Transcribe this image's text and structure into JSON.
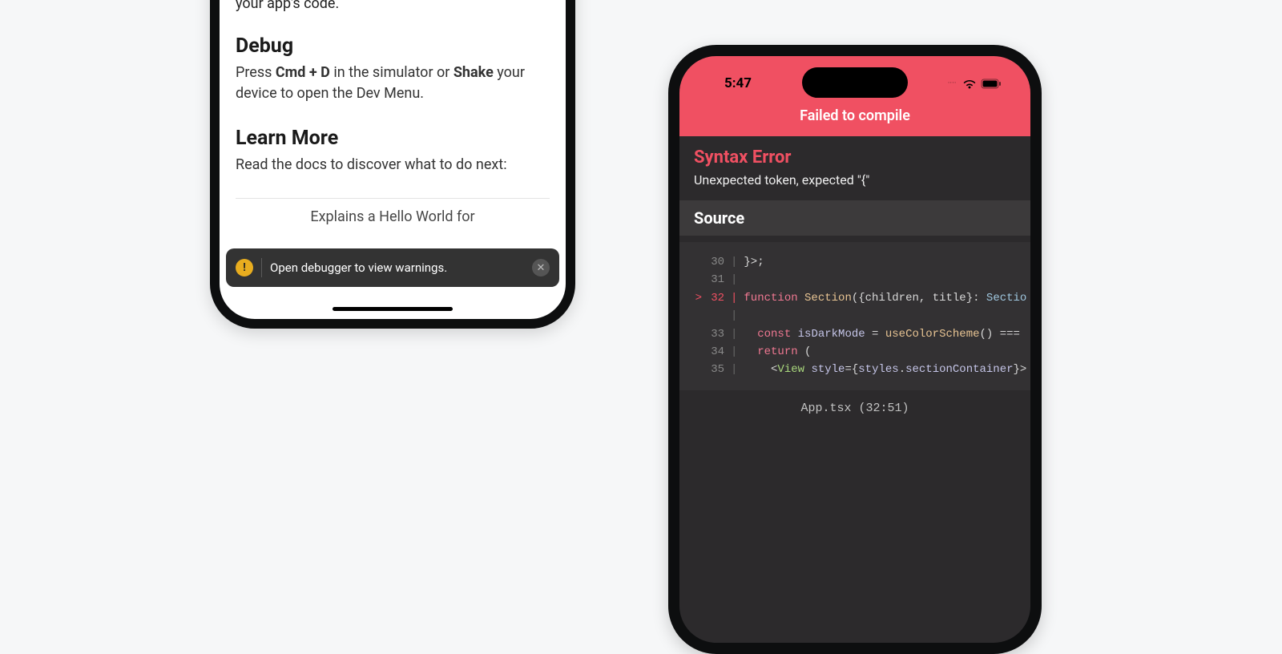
{
  "left": {
    "partial_tail": "your app's code.",
    "debug": {
      "heading": "Debug",
      "body_prefix": "Press ",
      "body_bold1": "Cmd + D",
      "body_mid": " in the simulator or ",
      "body_bold2": "Shake",
      "body_suffix": " your device to open the Dev Menu."
    },
    "learn": {
      "heading": "Learn More",
      "body": "Read the docs to discover what to do next:"
    },
    "explains_partial": "Explains a Hello World for",
    "toast": {
      "message": "Open debugger to view warnings.",
      "warn_glyph": "!",
      "close_glyph": "✕"
    }
  },
  "right": {
    "status": {
      "time": "5:47",
      "dots": "••••"
    },
    "banner": "Failed to compile",
    "error": {
      "title": "Syntax Error",
      "message": "Unexpected token, expected \"{\""
    },
    "source_label": "Source",
    "file_location": "App.tsx (32:51)",
    "code": {
      "lines": [
        {
          "n": "30",
          "marker": "",
          "html": "}>;"
        },
        {
          "n": "31",
          "marker": "",
          "html": ""
        },
        {
          "n": "32",
          "marker": ">",
          "html": "function Section({children, title}: Sectio"
        },
        {
          "n": "",
          "marker": "",
          "html": ""
        },
        {
          "n": "33",
          "marker": "",
          "html": "  const isDarkMode = useColorScheme() ==="
        },
        {
          "n": "34",
          "marker": "",
          "html": "  return ("
        },
        {
          "n": "35",
          "marker": "",
          "html": "    <View style={styles.sectionContainer}>"
        }
      ]
    }
  }
}
